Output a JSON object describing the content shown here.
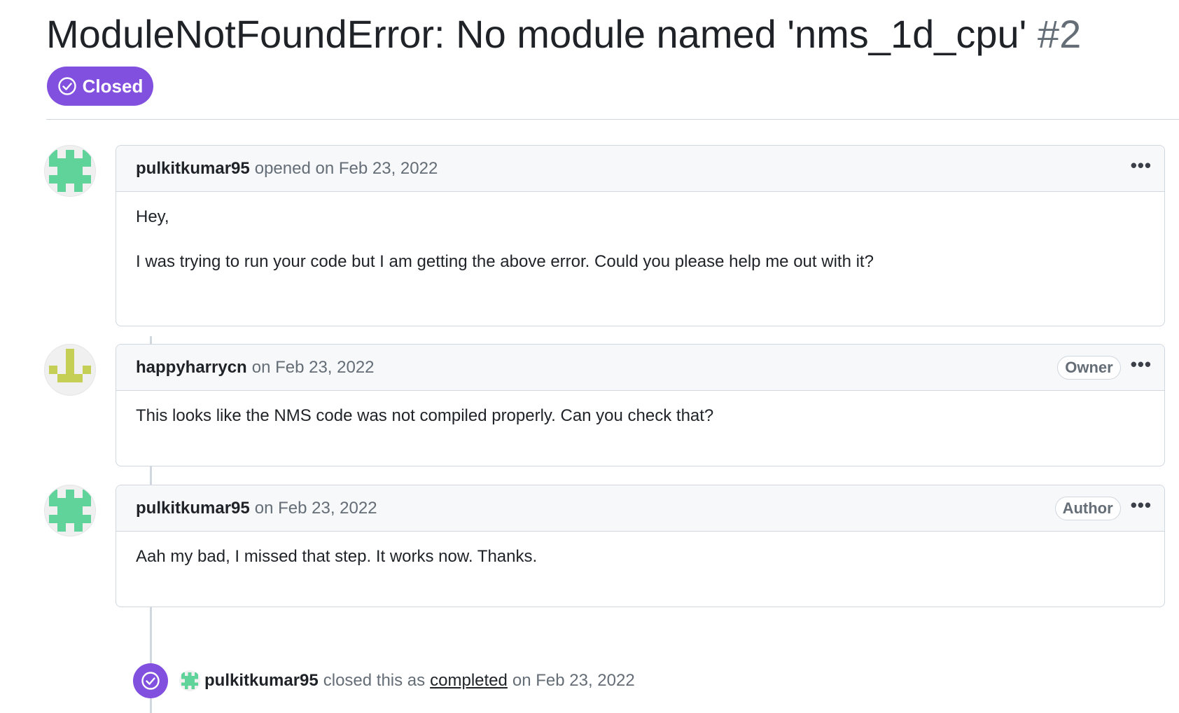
{
  "issue": {
    "title": "ModuleNotFoundError: No module named 'nms_1d_cpu'",
    "number": "#2",
    "state": "Closed",
    "state_color": "#8250df"
  },
  "comments": [
    {
      "author": "pulkitkumar95",
      "action": "opened on Feb 23, 2022",
      "role": "",
      "avatar_color": "#5fd39a",
      "body": [
        "Hey,",
        "I was trying to run your code but I am getting the above error. Could you please help me out with it?"
      ]
    },
    {
      "author": "happyharrycn",
      "action": "on Feb 23, 2022",
      "role": "Owner",
      "avatar_color": "#c5cf55",
      "body": [
        "This looks like the NMS code was not compiled properly. Can you check that?"
      ]
    },
    {
      "author": "pulkitkumar95",
      "action": "on Feb 23, 2022",
      "role": "Author",
      "avatar_color": "#5fd39a",
      "body": [
        "Aah my bad, I missed that step. It works now. Thanks."
      ]
    }
  ],
  "close_event": {
    "actor": "pulkitkumar95",
    "text_before": "closed this as",
    "link_text": "completed",
    "text_after": "on Feb 23, 2022",
    "icon": "check-circle-icon"
  },
  "menu_icon": "kebab-horizontal-icon"
}
